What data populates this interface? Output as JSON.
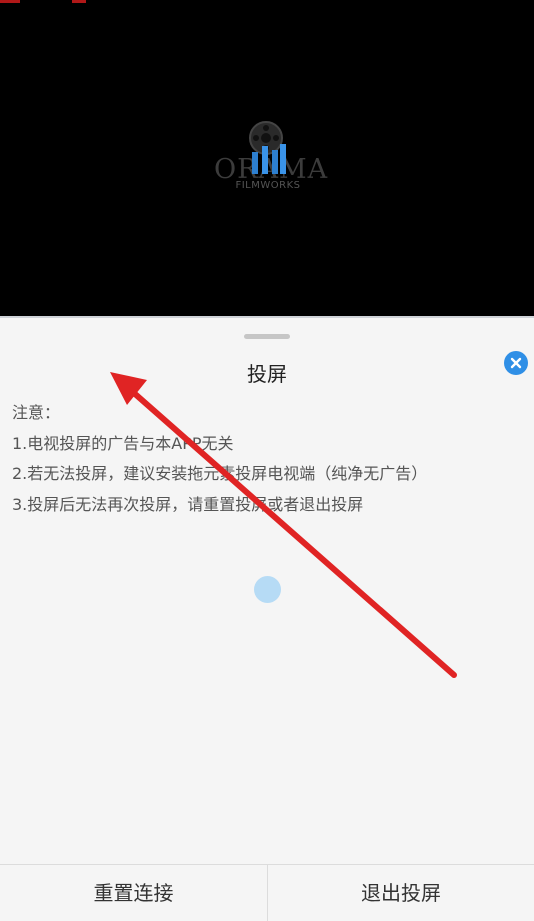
{
  "video": {
    "logo_text": "ORAMA",
    "logo_sub": "FILMWORKS"
  },
  "sheet": {
    "title": "投屏",
    "close_icon": "close-icon",
    "notes": [
      "注意：",
      "1.电视投屏的广告与本APP无关",
      "2.若无法投屏，建议安装拖元素投屏电视端（纯净无广告）",
      "3.投屏后无法再次投屏，请重置投屏或者退出投屏"
    ],
    "loading_indicator": "loading-spinner"
  },
  "footer": {
    "reset_label": "重置连接",
    "exit_label": "退出投屏"
  },
  "colors": {
    "accent": "#2f8fe6",
    "annotation_arrow": "#e02424",
    "sheet_bg": "#f5f5f5"
  }
}
